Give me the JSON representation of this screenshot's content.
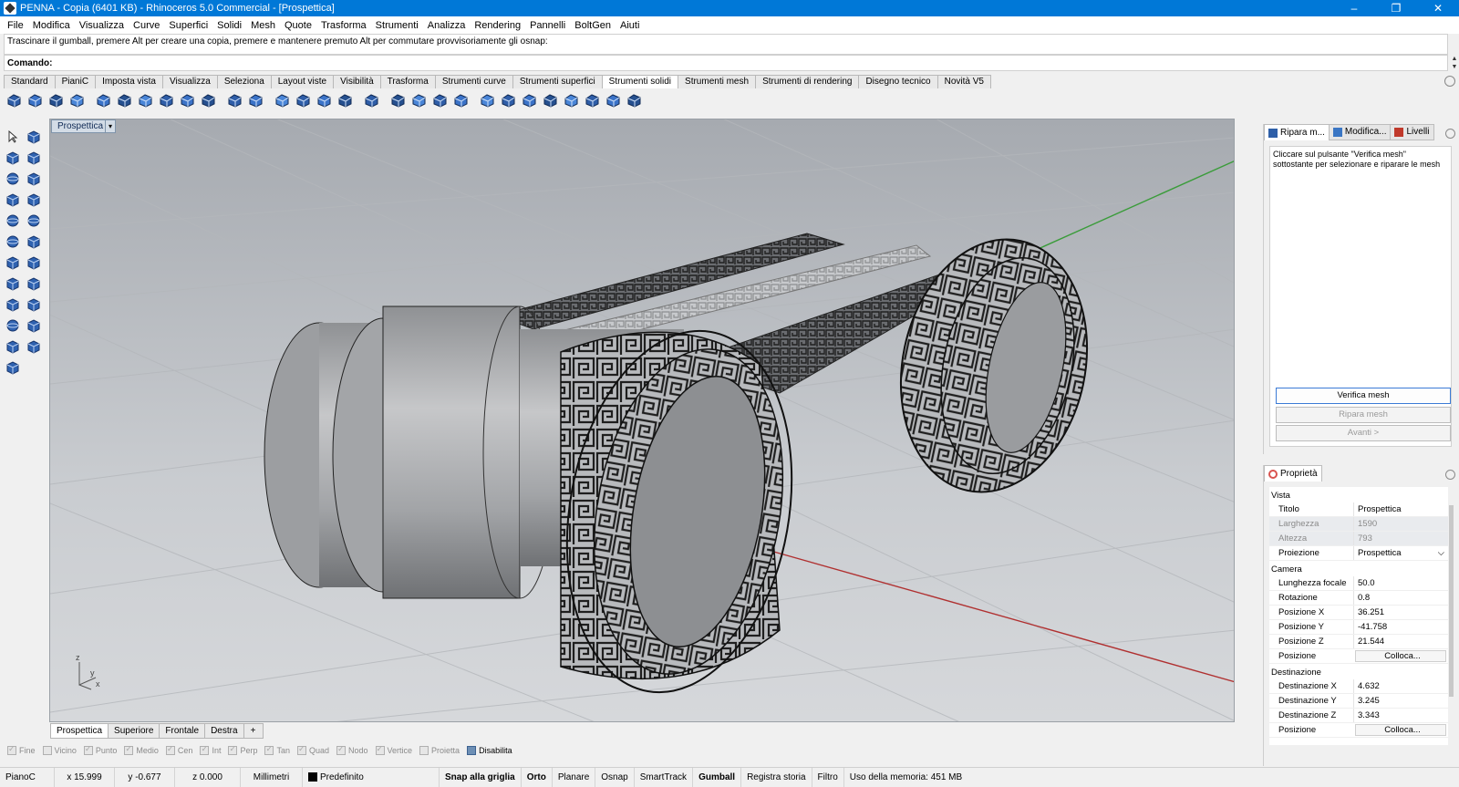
{
  "window": {
    "title": "PENNA - Copia (6401 KB) - Rhinoceros 5.0 Commercial - [Prospettica]",
    "minimize": "–",
    "maximize": "❐",
    "close": "✕"
  },
  "menu": [
    "File",
    "Modifica",
    "Visualizza",
    "Curve",
    "Superfici",
    "Solidi",
    "Mesh",
    "Quote",
    "Trasforma",
    "Strumenti",
    "Analizza",
    "Rendering",
    "Pannelli",
    "BoltGen",
    "Aiuti"
  ],
  "command": {
    "history": "Trascinare il gumball, premere Alt per creare una copia, premere e mantenere premuto Alt per commutare provvisoriamente gli osnap:",
    "label": "Comando:",
    "value": ""
  },
  "toolbar_tabs": [
    "Standard",
    "PianiC",
    "Imposta vista",
    "Visualizza",
    "Seleziona",
    "Layout viste",
    "Visibilità",
    "Trasforma",
    "Strumenti curve",
    "Strumenti superfici",
    "Strumenti solidi",
    "Strumenti mesh",
    "Strumenti di rendering",
    "Disegno tecnico",
    "Novità V5"
  ],
  "active_toolbar_tab": "Strumenti solidi",
  "toolbar_icons": [
    "boolean-union-icon",
    "boolean-difference-icon",
    "boolean-intersection-icon",
    "boolean-split-icon",
    "separator",
    "extrude-face-icon",
    "offset-surface-icon",
    "move-face-icon",
    "fillet-edges-icon",
    "shell-icon",
    "wire-cut-icon",
    "separator",
    "cap-holes-icon",
    "extract-surface-icon",
    "separator",
    "move-edge-icon",
    "split-edge-icon",
    "merge-edge-icon",
    "merge-faces-icon",
    "separator",
    "move-untrimmed-icon",
    "separator",
    "make-hole-icon",
    "move-hole-icon",
    "rotate-hole-icon",
    "array-hole-icon",
    "separator",
    "text-object-icon",
    "show-edges-icon",
    "blend-edges-icon",
    "chamfer-icon",
    "rebuild-icon",
    "grid-icon",
    "mesh-grid-icon",
    "delete-hole-icon"
  ],
  "left_tools": [
    [
      "select-arrow-icon",
      "scale-icon"
    ],
    [
      "point-icon",
      "polyline-icon"
    ],
    [
      "circle-icon",
      "spark-icon"
    ],
    [
      "box-icon",
      "box-solid-icon"
    ],
    [
      "sphere-icon",
      "sphere-solid-icon"
    ],
    [
      "ellipsoid-icon",
      "paraboloid-icon"
    ],
    [
      "cone-icon",
      "truncated-cone-icon"
    ],
    [
      "pyramid-icon",
      "wedge-icon"
    ],
    [
      "cylinder-icon",
      "tube-icon"
    ],
    [
      "torus-icon",
      "pipe-icon"
    ],
    [
      "revolve-icon",
      "extrude-icon"
    ],
    [
      "mesh-icon"
    ]
  ],
  "viewport": {
    "label": "Prospettica",
    "axis_z": "z",
    "axis_y": "y",
    "axis_x": "x"
  },
  "viewport_tabs": [
    "Prospettica",
    "Superiore",
    "Frontale",
    "Destra"
  ],
  "viewport_add": "+",
  "osnaps": [
    {
      "label": "Fine",
      "checked": true
    },
    {
      "label": "Vicino",
      "checked": false
    },
    {
      "label": "Punto",
      "checked": true
    },
    {
      "label": "Medio",
      "checked": true
    },
    {
      "label": "Cen",
      "checked": true
    },
    {
      "label": "Int",
      "checked": true
    },
    {
      "label": "Perp",
      "checked": true
    },
    {
      "label": "Tan",
      "checked": true
    },
    {
      "label": "Quad",
      "checked": true
    },
    {
      "label": "Nodo",
      "checked": true
    },
    {
      "label": "Vertice",
      "checked": true
    },
    {
      "label": "Proietta",
      "checked": false
    },
    {
      "label": "Disabilita",
      "checked": false
    }
  ],
  "status": {
    "plane": "PianoC",
    "x": "x 15.999",
    "y": "y -0.677",
    "z": "z 0.000",
    "units": "Millimetri",
    "layer": "Predefinito",
    "snap": "Snap alla griglia",
    "ortho": "Orto",
    "planar": "Planare",
    "osnap": "Osnap",
    "smarttrack": "SmartTrack",
    "gumball": "Gumball",
    "history": "Registra storia",
    "filter": "Filtro",
    "memory": "Uso della memoria: 451 MB"
  },
  "right_panel": {
    "tabs": [
      "Ripara m...",
      "Modifica...",
      "Livelli"
    ],
    "hint": "Cliccare sul pulsante \"Verifica mesh\" sottostante per selezionare e riparare le mesh",
    "check_button": "Verifica mesh",
    "repair_button": "Ripara mesh",
    "next_button": "Avanti >"
  },
  "properties": {
    "tab": "Proprietà",
    "group_view": "Vista",
    "title_k": "Titolo",
    "title_v": "Prospettica",
    "width_k": "Larghezza",
    "width_v": "1590",
    "height_k": "Altezza",
    "height_v": "793",
    "proj_k": "Proiezione",
    "proj_v": "Prospettica",
    "group_camera": "Camera",
    "focal_k": "Lunghezza focale",
    "focal_v": "50.0",
    "rot_k": "Rotazione",
    "rot_v": "0.8",
    "px_k": "Posizione X",
    "px_v": "36.251",
    "py_k": "Posizione Y",
    "py_v": "-41.758",
    "pz_k": "Posizione Z",
    "pz_v": "21.544",
    "pos_k": "Posizione",
    "pos_v": "Colloca...",
    "group_target": "Destinazione",
    "dx_k": "Destinazione X",
    "dx_v": "4.632",
    "dy_k": "Destinazione Y",
    "dy_v": "3.245",
    "dz_k": "Destinazione Z",
    "dz_v": "3.343",
    "pos2_k": "Posizione",
    "pos2_v": "Colloca..."
  }
}
